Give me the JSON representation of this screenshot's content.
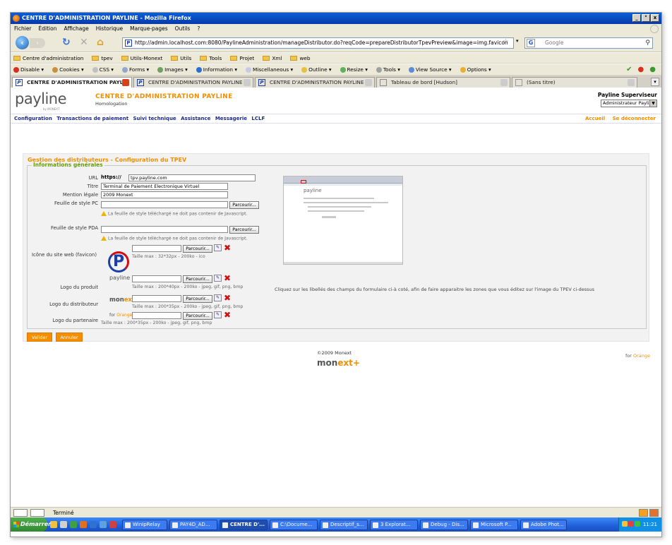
{
  "window": {
    "title": "CENTRE D'ADMINISTRATION PAYLINE - Mozilla Firefox",
    "controls": [
      "_",
      "°",
      "x"
    ]
  },
  "menu": [
    "Fichier",
    "Édition",
    "Affichage",
    "Historique",
    "Marque-pages",
    "Outils",
    "?"
  ],
  "nav": {
    "url": "http://admin.localhost.com:8080/PaylineAdministration/manageDistributor.do?reqCode=prepareDistributorTpevPreview&image=img.favicon",
    "search_placeholder": "Google",
    "favicon_letter": "P",
    "search_logo": "G"
  },
  "bookmarks": [
    "Centre d'administration",
    "tpev",
    "Utils-Monext",
    "Utils",
    "Tools",
    "Projet",
    "Xml",
    "web"
  ],
  "devbar": [
    "Disable ▾",
    "Cookies ▾",
    "CSS ▾",
    "Forms ▾",
    "Images ▾",
    "Information ▾",
    "Miscellaneous ▾",
    "Outline ▾",
    "Resize ▾",
    "Tools ▾",
    "View Source ▾",
    "Options ▾"
  ],
  "tabs": [
    "CENTRE D'ADMINISTRATION PAYL...",
    "CENTRE D'ADMINISTRATION PAYLINE",
    "CENTRE D'ADMINISTRATION PAYLINE",
    "Tableau de bord [Hudson]",
    "(Sans titre)"
  ],
  "header": {
    "logo": "payline",
    "logo_sub": "by MONEXT",
    "title": "CENTRE D'ADMINISTRATION PAYLINE",
    "subtitle": "Homologation",
    "role": "Payline Superviseur",
    "user": "Administrateur Payline"
  },
  "mainnav": [
    "Configuration",
    "Transactions de paiement",
    "Suivi technique",
    "Assistance",
    "Messagerie",
    "LCLF"
  ],
  "navright": [
    "Accueil",
    "Se déconnecter"
  ],
  "section": {
    "title": "Gestion des distributeurs - Configuration du TPEV",
    "legend": "Informations générales"
  },
  "form": {
    "url_label": "URL",
    "url_prefix": "https://",
    "url_value": "tpv.payline.com",
    "titre_label": "Titre",
    "titre_value": "Terminal de Paiement Electronique Virtuel",
    "mention_label": "Mention légale",
    "mention_value": "2009 Monext",
    "css_pc_label": "Feuille de style PC",
    "css_pda_label": "Feuille de style PDA",
    "browse": "Parcourir...",
    "css_hint": "La feuille de style téléchargé ne doit pas contenir de Javascript.",
    "favicon_label": "Icône du site web (favicon)",
    "favicon_hint": "Taille max : 32*32px - 200ko - ico",
    "produit_label": "Logo du produit",
    "produit_hint": "Taille max : 200*40px - 200ko - jpeg, gif, png, bmp",
    "distrib_label": "Logo du distributeur",
    "distrib_hint": "Taille max : 200*35px - 200ko - jpeg, gif, png, bmp",
    "partenaire_label": "Logo du partenaire",
    "partenaire_hint": "Taille max : 200*35px - 200ko - jpeg, gif, png, bmp"
  },
  "logos": {
    "payline": "payline",
    "monext_a": "mon",
    "monext_b": "ext",
    "monext_plus": "+",
    "orange_a": "for",
    "orange_b": "Orange"
  },
  "preview_note": "Cliquez sur les libellés des champs du formulaire ci-à coté, afin de faire apparaitre les zones que vous éditez sur l'image du TPEV ci-dessus",
  "buttons": {
    "validate": "Valider",
    "cancel": "Annuler"
  },
  "footer": {
    "copyright": "©2009 Monext",
    "orange_a": "for",
    "orange_b": "Orange"
  },
  "status": "Terminé",
  "taskbar": {
    "start": "Démarrer",
    "items": [
      "WinIpRelay",
      "PAY4D_AD...",
      "CENTRE D'...",
      "C:\\Docume...",
      "Descriptif_s...",
      "3 Explorat...",
      "Debug - Dis...",
      "Microsoft P...",
      "Adobe Phot..."
    ],
    "clock": "11:21"
  }
}
